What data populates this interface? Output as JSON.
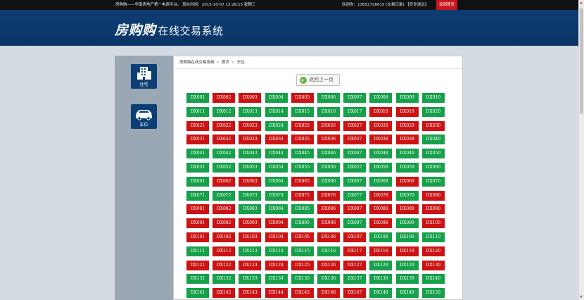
{
  "topbar": {
    "left_text": "房购购——华南房地产第一电商平台。 现在时间：2015-10-07 12:28:15 星期三",
    "welcome": "欢迎你：13652726615",
    "trade_record": "[交易记录]",
    "logout": "【安全退出】",
    "home": "返回首页"
  },
  "header": {
    "brand": "房购购",
    "subtitle": "在线交易系统"
  },
  "sidebar": {
    "items": [
      {
        "label": "住宅",
        "icon": "building-icon"
      },
      {
        "label": "车位",
        "icon": "car-icon"
      }
    ]
  },
  "breadcrumb": {
    "root": "房购购在线交易系统",
    "home": "首页",
    "current": "车位"
  },
  "back_button": "返回上一页",
  "colors": {
    "available": "#16a04a",
    "sold": "#cc1313",
    "navy": "#0b3e73"
  },
  "slot_legend": {
    "g": "available",
    "r": "sold"
  },
  "slot_rows": [
    {
      "prefix": "DX",
      "start": 1,
      "status": "grrgrggggg"
    },
    {
      "prefix": "DX",
      "start": 11,
      "status": "gggggggrrg"
    },
    {
      "prefix": "DX",
      "start": 21,
      "status": "rrrgrrrrrr"
    },
    {
      "prefix": "DX",
      "start": 31,
      "status": "rrrrrrrrrg"
    },
    {
      "prefix": "DX",
      "start": 41,
      "status": "gggggggggg"
    },
    {
      "prefix": "DX",
      "start": 51,
      "status": "gggggggggg"
    },
    {
      "prefix": "DX",
      "start": 61,
      "status": "grrgrgggrg"
    },
    {
      "prefix": "DX",
      "start": 71,
      "status": "ggggrrgrgr"
    },
    {
      "prefix": "DX",
      "start": 81,
      "status": "rrgggrrrrr"
    },
    {
      "prefix": "DX",
      "start": 91,
      "status": "rrrrgrgrgr"
    },
    {
      "prefix": "DX",
      "start": 101,
      "status": "rrrrrrrggg"
    },
    {
      "prefix": "DX",
      "start": 111,
      "status": "grggggrrrr"
    },
    {
      "prefix": "DX",
      "start": 121,
      "status": "rrrrrrrggr"
    },
    {
      "prefix": "DX",
      "start": 131,
      "status": "gggggggggg"
    },
    {
      "prefix": "DX",
      "start": 141,
      "status": "grrrrrrggg"
    }
  ]
}
